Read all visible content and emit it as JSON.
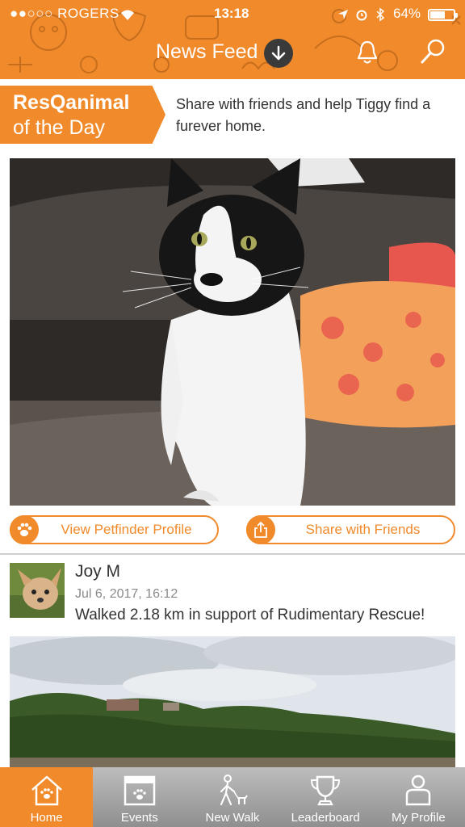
{
  "status_bar": {
    "carrier": "●●○○○ ROGERS",
    "time": "13:18",
    "battery_percent": "64%",
    "battery_level": 0.64
  },
  "header": {
    "title": "News Feed",
    "icons": [
      "chevron-down-icon",
      "bell-icon",
      "search-icon"
    ]
  },
  "animal_of_day": {
    "ribbon_line1": "ResQanimal",
    "ribbon_line2": "of the Day",
    "message": "Share with friends and help Tiggy find a furever home.",
    "buttons": {
      "petfinder": "View Petfinder Profile",
      "share": "Share with Friends"
    }
  },
  "post": {
    "author": "Joy M",
    "date": "Jul 6, 2017, 16:12",
    "text": "Walked 2.18 km in support of Rudimentary Rescue!"
  },
  "tabs": [
    {
      "label": "Home",
      "icon": "home-icon",
      "active": true
    },
    {
      "label": "Events",
      "icon": "calendar-icon",
      "active": false
    },
    {
      "label": "New Walk",
      "icon": "walker-icon",
      "active": false
    },
    {
      "label": "Leaderboard",
      "icon": "trophy-icon",
      "active": false
    },
    {
      "label": "My Profile",
      "icon": "person-icon",
      "active": false
    }
  ],
  "colors": {
    "brand_orange": "#f08a2b",
    "tabbar_gray": "#a0a0a0",
    "text_dark": "#333333",
    "date_gray": "#8a8a8a"
  }
}
